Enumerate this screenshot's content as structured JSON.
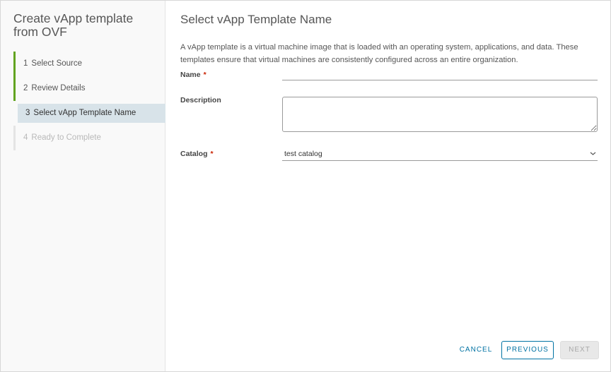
{
  "wizard": {
    "title": "Create vApp template from OVF"
  },
  "steps": [
    {
      "number": "1",
      "label": "Select Source",
      "state": "complete"
    },
    {
      "number": "2",
      "label": "Review Details",
      "state": "complete"
    },
    {
      "number": "3",
      "label": "Select vApp Template Name",
      "state": "active"
    },
    {
      "number": "4",
      "label": "Ready to Complete",
      "state": "disabled"
    }
  ],
  "page": {
    "title": "Select vApp Template Name",
    "description": "A vApp template is a virtual machine image that is loaded with an operating system, applications, and data. These templates ensure that virtual machines are consistently configured across an entire organization."
  },
  "form": {
    "name": {
      "label": "Name",
      "required_mark": "*",
      "value": "",
      "placeholder": ""
    },
    "description": {
      "label": "Description",
      "value": "",
      "placeholder": ""
    },
    "catalog": {
      "label": "Catalog",
      "required_mark": "*",
      "selected": "test catalog",
      "icon": "chevron-down-icon"
    }
  },
  "buttons": {
    "cancel": "CANCEL",
    "previous": "PREVIOUS",
    "next": "NEXT"
  },
  "colors": {
    "accent": "#0072a3",
    "step_complete": "#62a420",
    "step_active_bg": "#d8e3e9",
    "required": "#c92100"
  }
}
